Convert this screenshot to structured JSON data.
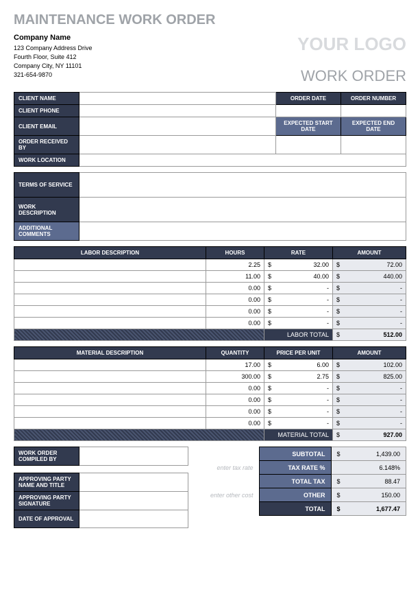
{
  "title": "MAINTENANCE WORK ORDER",
  "company": {
    "name": "Company Name",
    "addr1": "123 Company Address Drive",
    "addr2": "Fourth Floor, Suite 412",
    "addr3": "Company City, NY 11101",
    "phone": "321-654-9870"
  },
  "logo": "YOUR LOGO",
  "doc_type": "WORK ORDER",
  "fields": {
    "client_name": "CLIENT NAME",
    "client_phone": "CLIENT PHONE",
    "client_email": "CLIENT EMAIL",
    "order_received_by": "ORDER RECEIVED BY",
    "work_location": "WORK LOCATION",
    "order_date": "ORDER DATE",
    "order_number": "ORDER NUMBER",
    "expected_start": "EXPECTED START DATE",
    "expected_end": "EXPECTED END DATE",
    "terms": "TERMS OF SERVICE",
    "work_desc": "WORK DESCRIPTION",
    "additional": "ADDITIONAL COMMENTS"
  },
  "labor": {
    "headers": {
      "desc": "LABOR DESCRIPTION",
      "hours": "HOURS",
      "rate": "RATE",
      "amount": "AMOUNT"
    },
    "rows": [
      {
        "desc": "",
        "hours": "2.25",
        "rate": "32.00",
        "amount": "72.00"
      },
      {
        "desc": "",
        "hours": "11.00",
        "rate": "40.00",
        "amount": "440.00"
      },
      {
        "desc": "",
        "hours": "0.00",
        "rate": "-",
        "amount": "-"
      },
      {
        "desc": "",
        "hours": "0.00",
        "rate": "-",
        "amount": "-"
      },
      {
        "desc": "",
        "hours": "0.00",
        "rate": "-",
        "amount": "-"
      },
      {
        "desc": "",
        "hours": "0.00",
        "rate": "-",
        "amount": "-"
      }
    ],
    "total_label": "LABOR TOTAL",
    "total": "512.00"
  },
  "material": {
    "headers": {
      "desc": "MATERIAL DESCRIPTION",
      "qty": "QUANTITY",
      "ppu": "PRICE PER UNIT",
      "amount": "AMOUNT"
    },
    "rows": [
      {
        "desc": "",
        "qty": "17.00",
        "ppu": "6.00",
        "amount": "102.00"
      },
      {
        "desc": "",
        "qty": "300.00",
        "ppu": "2.75",
        "amount": "825.00"
      },
      {
        "desc": "",
        "qty": "0.00",
        "ppu": "-",
        "amount": "-"
      },
      {
        "desc": "",
        "qty": "0.00",
        "ppu": "-",
        "amount": "-"
      },
      {
        "desc": "",
        "qty": "0.00",
        "ppu": "-",
        "amount": "-"
      },
      {
        "desc": "",
        "qty": "0.00",
        "ppu": "-",
        "amount": "-"
      }
    ],
    "total_label": "MATERIAL TOTAL",
    "total": "927.00"
  },
  "approval": {
    "compiled_by": "WORK ORDER COMPILED BY",
    "approving_party": "APPROVING PARTY NAME AND TITLE",
    "signature": "APPROVING PARTY SIGNATURE",
    "date": "DATE OF APPROVAL"
  },
  "summary": {
    "hint_tax": "enter tax rate",
    "hint_other": "enter other cost",
    "subtotal_l": "SUBTOTAL",
    "subtotal": "1,439.00",
    "taxrate_l": "TAX RATE %",
    "taxrate": "6.148%",
    "totaltax_l": "TOTAL TAX",
    "totaltax": "88.47",
    "other_l": "OTHER",
    "other": "150.00",
    "total_l": "TOTAL",
    "total": "1,677.47"
  }
}
